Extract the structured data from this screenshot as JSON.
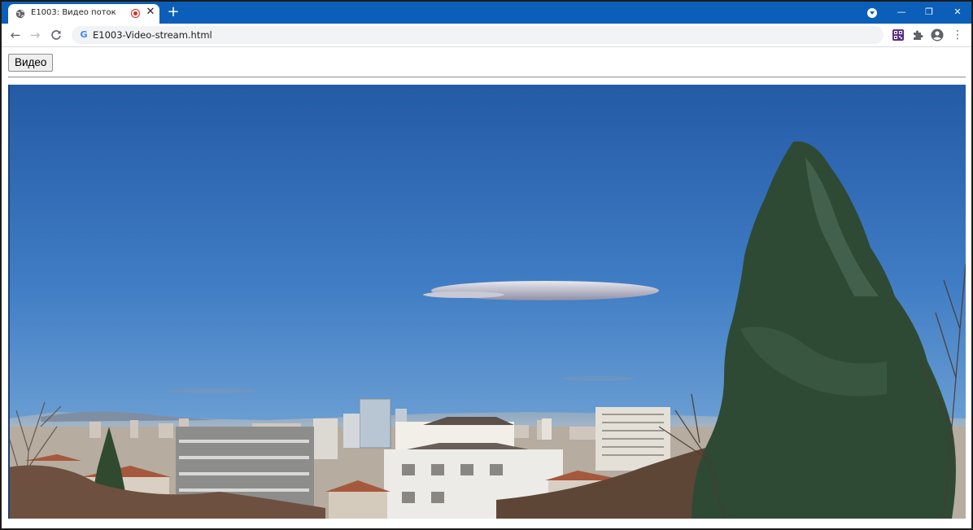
{
  "browser": {
    "tab_title": "E1003: Видео поток",
    "tab_favicon": "globe-icon",
    "new_tab_label": "+",
    "url": "E1003-Video-stream.html",
    "window_controls": {
      "minimize": "—",
      "maximize": "❐",
      "close": "✕"
    }
  },
  "toolbar": {
    "back": "←",
    "forward": "→",
    "reload": "C",
    "menu": "⋮",
    "extensions": [
      "qr-code-icon",
      "puzzle-icon",
      "account-icon"
    ]
  },
  "page": {
    "video_button_label": "Видео",
    "video_frame": "city skyline with trees under blue sky"
  },
  "colors": {
    "titlebar": "#0b5fb8",
    "record_indicator": "#d93025"
  }
}
